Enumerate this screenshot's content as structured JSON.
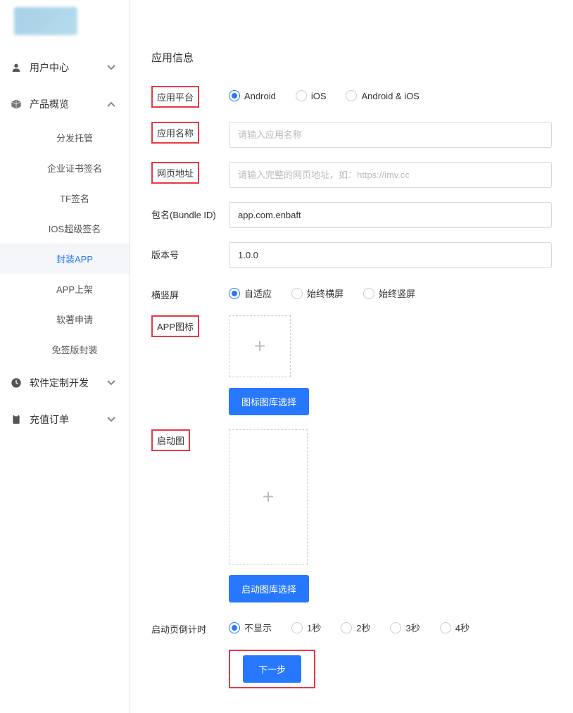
{
  "sidebar": {
    "items": [
      {
        "label": "用户中心",
        "expanded": false
      },
      {
        "label": "产品概览",
        "expanded": true,
        "children": [
          {
            "label": "分发托管"
          },
          {
            "label": "企业证书签名"
          },
          {
            "label": "TF签名"
          },
          {
            "label": "IOS超级签名"
          },
          {
            "label": "封装APP",
            "active": true
          },
          {
            "label": "APP上架"
          },
          {
            "label": "软著申请"
          },
          {
            "label": "免签版封装"
          }
        ]
      },
      {
        "label": "软件定制开发",
        "expanded": false
      },
      {
        "label": "充值订单",
        "expanded": false
      }
    ]
  },
  "main": {
    "section_title": "应用信息",
    "fields": {
      "platform": {
        "label": "应用平台",
        "options": [
          "Android",
          "iOS",
          "Android & iOS"
        ],
        "selected": "Android"
      },
      "app_name": {
        "label": "应用名称",
        "placeholder": "请输入应用名称",
        "value": ""
      },
      "web_url": {
        "label": "网页地址",
        "placeholder": "请输入完整的网页地址，如：https://imv.cc",
        "value": ""
      },
      "bundle_id": {
        "label": "包名(Bundle ID)",
        "value": "app.com.enbaft"
      },
      "version": {
        "label": "版本号",
        "value": "1.0.0"
      },
      "orientation": {
        "label": "横竖屏",
        "options": [
          "自适应",
          "始终横屏",
          "始终竖屏"
        ],
        "selected": "自适应"
      },
      "app_icon": {
        "label": "APP图标",
        "button": "图标图库选择"
      },
      "launch_image": {
        "label": "启动图",
        "button": "启动图库选择"
      },
      "countdown": {
        "label": "启动页倒计时",
        "options": [
          "不显示",
          "1秒",
          "2秒",
          "3秒",
          "4秒"
        ],
        "selected": "不显示"
      }
    },
    "next_button": "下一步"
  }
}
